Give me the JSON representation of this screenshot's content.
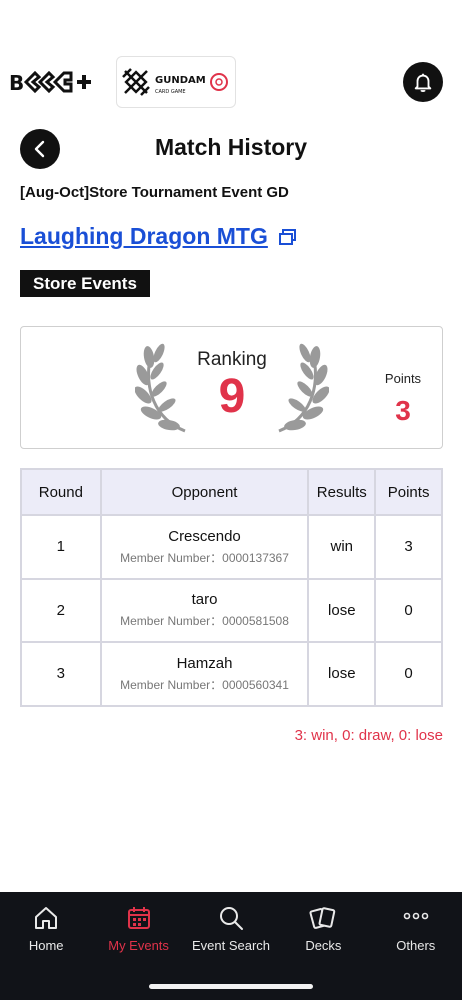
{
  "header": {
    "logo_left_text": "BCG+",
    "logo_right_text": "GUNDAM",
    "logo_right_sub": "CARD GAME",
    "bell_icon": "bell-icon"
  },
  "page": {
    "title": "Match History",
    "event_name": "[Aug-Oct]Store Tournament Event GD",
    "store_name": "Laughing Dragon MTG",
    "badge": "Store Events"
  },
  "ranking": {
    "label": "Ranking",
    "value": "9",
    "points_label": "Points",
    "points_value": "3"
  },
  "table": {
    "headers": [
      "Round",
      "Opponent",
      "Results",
      "Points"
    ],
    "rows": [
      {
        "round": "1",
        "opponent": "Crescendo",
        "member": "Member Number：0000137367",
        "result": "win",
        "points": "3"
      },
      {
        "round": "2",
        "opponent": "taro",
        "member": "Member Number：0000581508",
        "result": "lose",
        "points": "0"
      },
      {
        "round": "3",
        "opponent": "Hamzah",
        "member": "Member Number：0000560341",
        "result": "lose",
        "points": "0"
      }
    ]
  },
  "summary": "3: win, 0: draw, 0: lose",
  "tabs": [
    {
      "label": "Home",
      "icon": "home-icon"
    },
    {
      "label": "My Events",
      "icon": "calendar-icon",
      "active": true
    },
    {
      "label": "Event Search",
      "icon": "search-icon"
    },
    {
      "label": "Decks",
      "icon": "cards-icon"
    },
    {
      "label": "Others",
      "icon": "more-icon"
    }
  ],
  "colors": {
    "accent": "#e0334a",
    "link": "#1a4fd6",
    "tabbar": "#111318"
  }
}
